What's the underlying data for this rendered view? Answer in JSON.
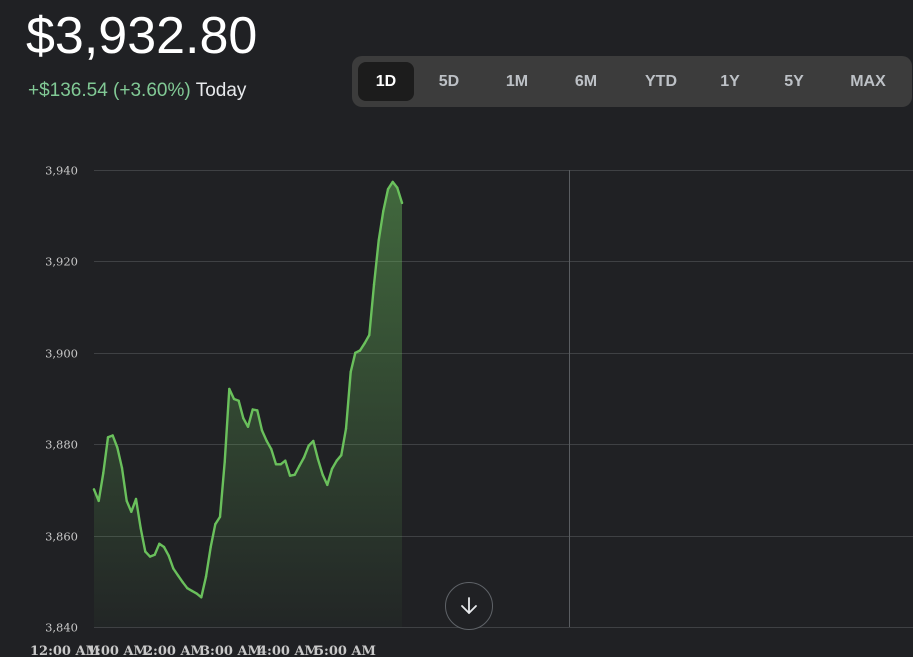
{
  "header": {
    "price": "$3,932.80",
    "change": "+$136.54 (+3.60%)",
    "change_label": "Today"
  },
  "ranges": [
    {
      "label": "1D",
      "active": true
    },
    {
      "label": "5D",
      "active": false
    },
    {
      "label": "1M",
      "active": false
    },
    {
      "label": "6M",
      "active": false
    },
    {
      "label": "YTD",
      "active": false
    },
    {
      "label": "1Y",
      "active": false
    },
    {
      "label": "5Y",
      "active": false
    },
    {
      "label": "MAX",
      "active": false
    }
  ],
  "colors": {
    "line": "#6ac05c",
    "positive": "#81c995",
    "background": "#202124"
  },
  "icons": {
    "scroll": "arrow-down-icon"
  },
  "chart_data": {
    "type": "area",
    "ylim": [
      3840,
      3940
    ],
    "y_ticks": [
      3940,
      3920,
      3900,
      3880,
      3860,
      3840
    ],
    "y_tick_labels": [
      "3,940",
      "3,920",
      "3,900",
      "3,880",
      "3,860",
      "3,840"
    ],
    "x_tick_labels": [
      "12:00 AM",
      "1:00 AM",
      "2:00 AM",
      "3:00 AM",
      "4:00 AM",
      "5:00 AM"
    ],
    "grid": true,
    "legend": "none",
    "series": [
      {
        "values": [
          3870.1,
          3867.6,
          3873.7,
          3881.5,
          3881.9,
          3879.3,
          3874.8,
          3867.6,
          3865.2,
          3868.0,
          3861.6,
          3856.5,
          3855.4,
          3855.8,
          3858.2,
          3857.5,
          3855.6,
          3852.8,
          3851.3,
          3849.8,
          3848.5,
          3847.9,
          3847.3,
          3846.5,
          3851.0,
          3857.5,
          3862.5,
          3864.1,
          3876.1,
          3892.1,
          3889.9,
          3889.5,
          3885.7,
          3883.8,
          3887.6,
          3887.4,
          3883.0,
          3880.7,
          3878.9,
          3875.6,
          3875.6,
          3876.4,
          3873.1,
          3873.3,
          3875.2,
          3877.1,
          3879.7,
          3880.7,
          3876.7,
          3873.3,
          3871.1,
          3874.6,
          3876.4,
          3877.6,
          3883.4,
          3895.8,
          3900.0,
          3900.5,
          3902.1,
          3903.9,
          3914.9,
          3924.6,
          3931.0,
          3935.8,
          3937.4,
          3936.1,
          3932.8
        ]
      }
    ]
  }
}
